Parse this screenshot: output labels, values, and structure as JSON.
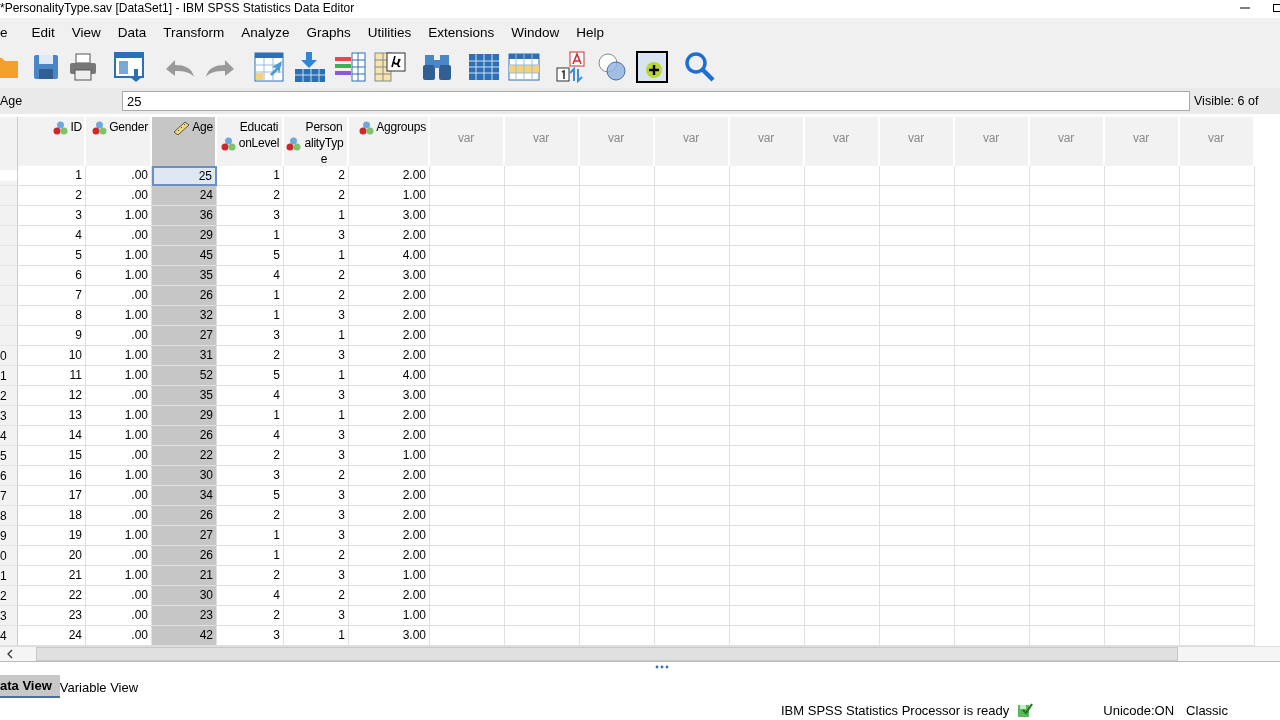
{
  "window": {
    "title": "*PersonalityType.sav [DataSet1] - IBM SPSS Statistics Data Editor"
  },
  "menu": [
    "e",
    "Edit",
    "View",
    "Data",
    "Transform",
    "Analyze",
    "Graphs",
    "Utilities",
    "Extensions",
    "Window",
    "Help"
  ],
  "cell_editor": {
    "variable": "Age",
    "value": "25",
    "visible": "Visible: 6 of"
  },
  "columns": [
    {
      "label": "ID",
      "kind": "nominal",
      "selected": false
    },
    {
      "label": "Gender",
      "kind": "nominal",
      "selected": false
    },
    {
      "label": "Age",
      "kind": "scale",
      "selected": true
    },
    {
      "label": "EducationLevel",
      "kind": "nominal",
      "selected": false
    },
    {
      "label": "PersonalityType",
      "kind": "nominal",
      "selected": false
    },
    {
      "label": "Aggroups",
      "kind": "nominal",
      "selected": false
    },
    {
      "label": "var",
      "kind": "empty",
      "selected": false
    },
    {
      "label": "var",
      "kind": "empty",
      "selected": false
    },
    {
      "label": "var",
      "kind": "empty",
      "selected": false
    },
    {
      "label": "var",
      "kind": "empty",
      "selected": false
    },
    {
      "label": "var",
      "kind": "empty",
      "selected": false
    },
    {
      "label": "var",
      "kind": "empty",
      "selected": false
    },
    {
      "label": "var",
      "kind": "empty",
      "selected": false
    },
    {
      "label": "var",
      "kind": "empty",
      "selected": false
    },
    {
      "label": "var",
      "kind": "empty",
      "selected": false
    },
    {
      "label": "var",
      "kind": "empty",
      "selected": false
    },
    {
      "label": "var",
      "kind": "empty",
      "selected": false
    }
  ],
  "rows": [
    {
      "selected": true,
      "cells": [
        "1",
        ".00",
        "25",
        "1",
        "2",
        "2.00"
      ]
    },
    {
      "selected": false,
      "cells": [
        "2",
        ".00",
        "24",
        "2",
        "2",
        "1.00"
      ]
    },
    {
      "selected": false,
      "cells": [
        "3",
        "1.00",
        "36",
        "3",
        "1",
        "3.00"
      ]
    },
    {
      "selected": false,
      "cells": [
        "4",
        ".00",
        "29",
        "1",
        "3",
        "2.00"
      ]
    },
    {
      "selected": false,
      "cells": [
        "5",
        "1.00",
        "45",
        "5",
        "1",
        "4.00"
      ]
    },
    {
      "selected": false,
      "cells": [
        "6",
        "1.00",
        "35",
        "4",
        "2",
        "3.00"
      ]
    },
    {
      "selected": false,
      "cells": [
        "7",
        ".00",
        "26",
        "1",
        "2",
        "2.00"
      ]
    },
    {
      "selected": false,
      "cells": [
        "8",
        "1.00",
        "32",
        "1",
        "3",
        "2.00"
      ]
    },
    {
      "selected": false,
      "cells": [
        "9",
        ".00",
        "27",
        "3",
        "1",
        "2.00"
      ]
    },
    {
      "row_label": "0",
      "selected": false,
      "cells": [
        "10",
        "1.00",
        "31",
        "2",
        "3",
        "2.00"
      ]
    },
    {
      "row_label": "1",
      "selected": false,
      "cells": [
        "11",
        "1.00",
        "52",
        "5",
        "1",
        "4.00"
      ]
    },
    {
      "row_label": "2",
      "selected": false,
      "cells": [
        "12",
        ".00",
        "35",
        "4",
        "3",
        "3.00"
      ]
    },
    {
      "row_label": "3",
      "selected": false,
      "cells": [
        "13",
        "1.00",
        "29",
        "1",
        "1",
        "2.00"
      ]
    },
    {
      "row_label": "4",
      "selected": false,
      "cells": [
        "14",
        "1.00",
        "26",
        "4",
        "3",
        "2.00"
      ]
    },
    {
      "row_label": "5",
      "selected": false,
      "cells": [
        "15",
        ".00",
        "22",
        "2",
        "3",
        "1.00"
      ]
    },
    {
      "row_label": "6",
      "selected": false,
      "cells": [
        "16",
        "1.00",
        "30",
        "3",
        "2",
        "2.00"
      ]
    },
    {
      "row_label": "7",
      "selected": false,
      "cells": [
        "17",
        ".00",
        "34",
        "5",
        "3",
        "2.00"
      ]
    },
    {
      "row_label": "8",
      "selected": false,
      "cells": [
        "18",
        ".00",
        "26",
        "2",
        "3",
        "2.00"
      ]
    },
    {
      "row_label": "9",
      "selected": false,
      "cells": [
        "19",
        "1.00",
        "27",
        "1",
        "3",
        "2.00"
      ]
    },
    {
      "row_label": "0",
      "selected": false,
      "cells": [
        "20",
        ".00",
        "26",
        "1",
        "2",
        "2.00"
      ]
    },
    {
      "row_label": "1",
      "selected": false,
      "cells": [
        "21",
        "1.00",
        "21",
        "2",
        "3",
        "1.00"
      ]
    },
    {
      "row_label": "2",
      "selected": false,
      "cells": [
        "22",
        ".00",
        "30",
        "4",
        "2",
        "2.00"
      ]
    },
    {
      "row_label": "3",
      "selected": false,
      "cells": [
        "23",
        ".00",
        "23",
        "2",
        "3",
        "1.00"
      ]
    },
    {
      "row_label": "4",
      "selected": false,
      "cells": [
        "24",
        ".00",
        "42",
        "3",
        "1",
        "3.00"
      ]
    }
  ],
  "tabs": [
    {
      "label": "ata View",
      "selected": true
    },
    {
      "label": "Variable View",
      "selected": false
    }
  ],
  "status_bar": {
    "message": "IBM SPSS Statistics Processor is ready",
    "encoding": "Unicode:ON",
    "mode": "Classic"
  }
}
